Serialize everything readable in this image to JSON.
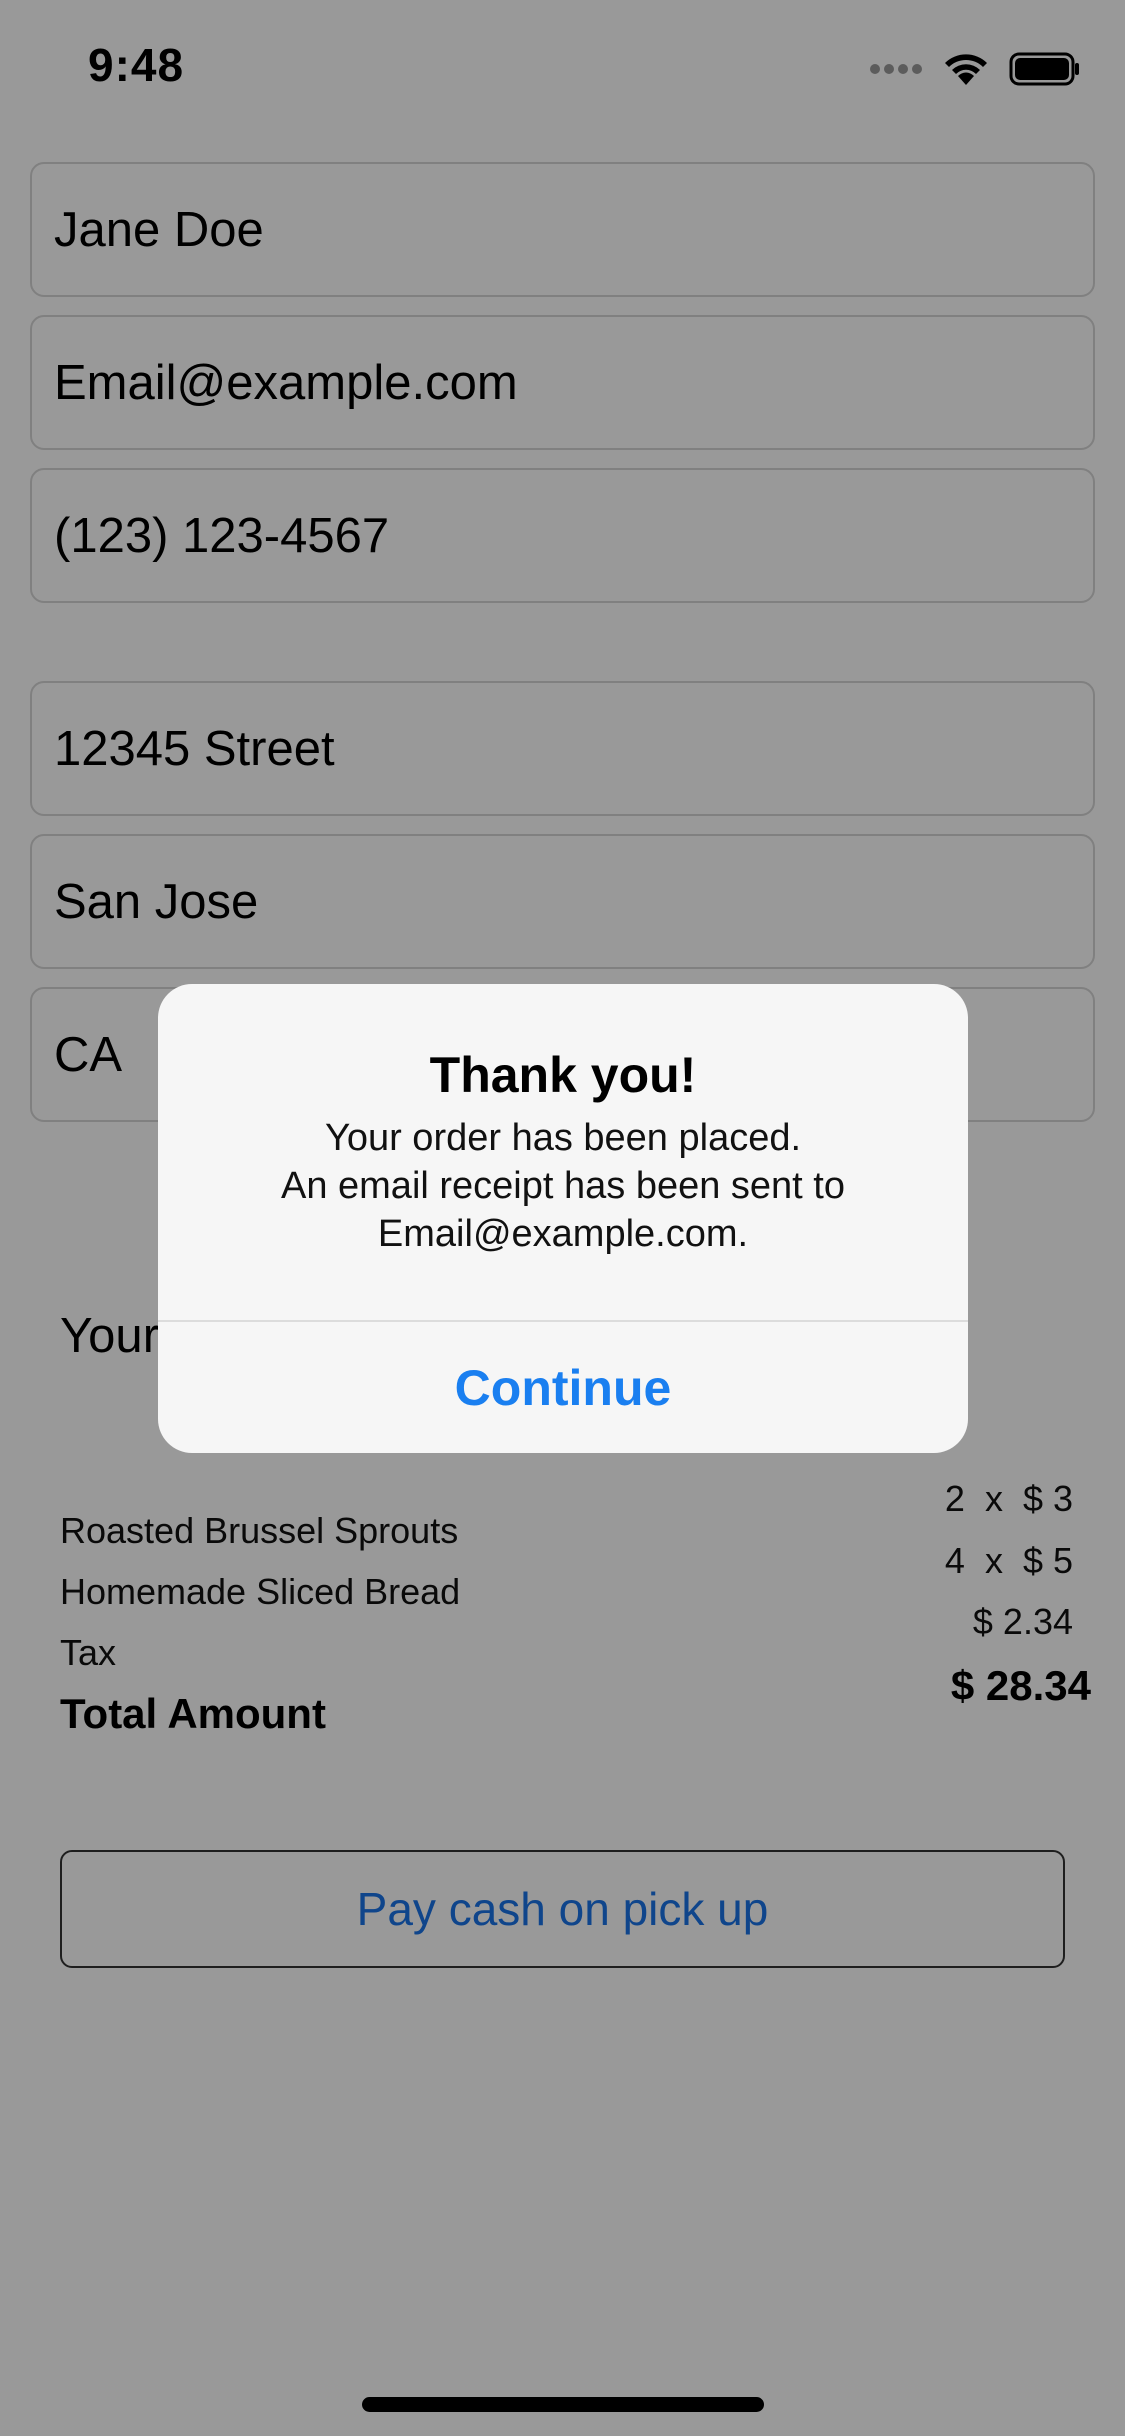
{
  "status_bar": {
    "time": "9:48"
  },
  "form": {
    "name": "Jane Doe",
    "email": "Email@example.com",
    "phone": "(123) 123-4567",
    "street": "12345 Street",
    "city": "San Jose",
    "state": "CA"
  },
  "order": {
    "heading_visible": "Your",
    "items": [
      {
        "label": "Roasted Brussel Sprouts",
        "value": "2  x  $ 3"
      },
      {
        "label": "Homemade Sliced Bread",
        "value": "4  x  $ 5"
      },
      {
        "label": "Tax",
        "value": "$ 2.34"
      }
    ],
    "total_label": "Total Amount",
    "total_value": "$ 28.34"
  },
  "pay_button": {
    "label": "Pay cash on pick up"
  },
  "alert": {
    "title": "Thank you!",
    "message_line1": "Your order has been placed.",
    "message_line2": "An email receipt has been sent to",
    "message_line3": "Email@example.com.",
    "button_label": "Continue"
  },
  "colors": {
    "accent": "#1a7ff0",
    "overlay": "rgba(0,0,0,0.40)"
  }
}
